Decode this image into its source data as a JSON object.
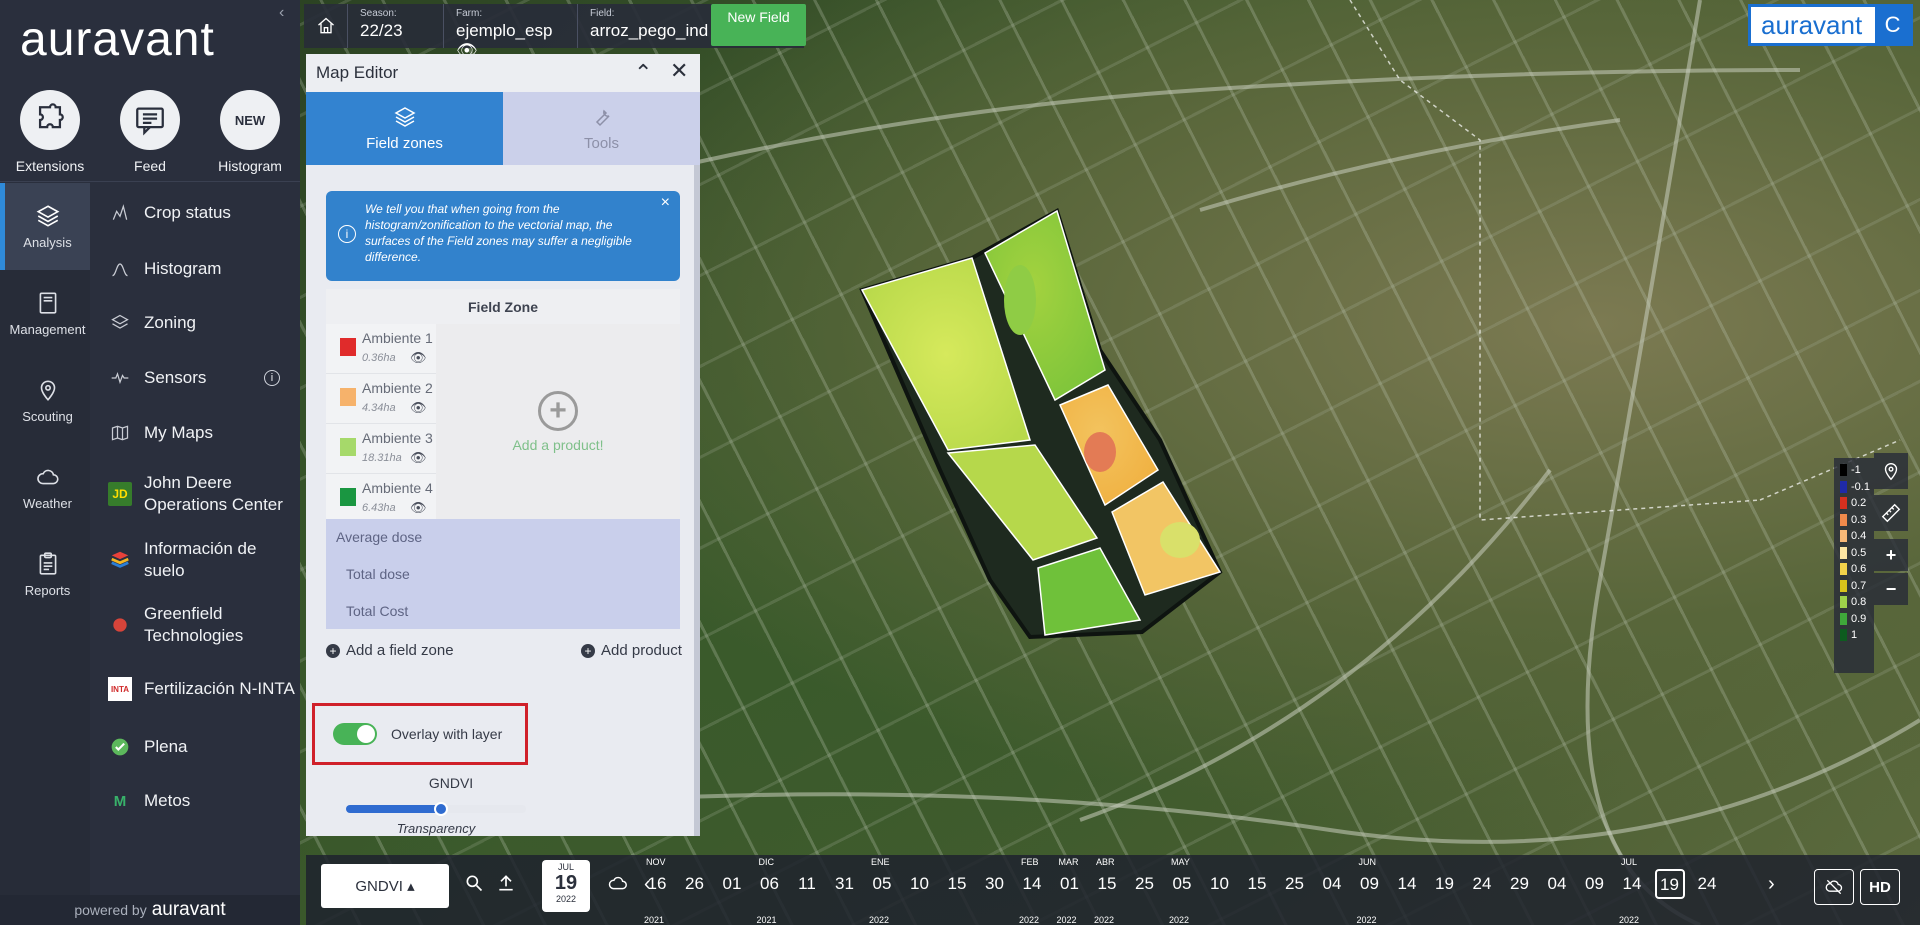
{
  "sidebar": {
    "logo": "auravant",
    "quick": [
      {
        "label": "Extensions",
        "icon": "puzzle-icon",
        "text": ""
      },
      {
        "label": "Feed",
        "icon": "chat-icon",
        "text": ""
      },
      {
        "label": "Histogram",
        "icon": "new-badge",
        "text": "NEW"
      }
    ],
    "nav": [
      {
        "label": "Analysis",
        "icon": "layers-icon",
        "active": true
      },
      {
        "label": "Management",
        "icon": "book-icon",
        "active": false
      },
      {
        "label": "Scouting",
        "icon": "map-pin-icon",
        "active": false
      },
      {
        "label": "Weather",
        "icon": "cloud-icon",
        "active": false
      },
      {
        "label": "Reports",
        "icon": "clipboard-icon",
        "active": false
      }
    ],
    "menu": [
      {
        "label": "Crop status",
        "icon": "crop-status-icon"
      },
      {
        "label": "Histogram",
        "icon": "histogram-icon"
      },
      {
        "label": "Zoning",
        "icon": "zoning-icon"
      },
      {
        "label": "Sensors",
        "icon": "sensors-icon"
      },
      {
        "label": "My Maps",
        "icon": "maps-icon"
      },
      {
        "label": "John Deere Operations Center",
        "icon": "john-deere-icon"
      },
      {
        "label": "Información de suelo",
        "icon": "soil-info-icon"
      },
      {
        "label": "Greenfield Technologies",
        "icon": "greenfield-icon"
      },
      {
        "label": "Fertilización N-INTA",
        "icon": "inta-icon"
      },
      {
        "label": "Plena",
        "icon": "plena-icon"
      },
      {
        "label": "Metos",
        "icon": "metos-icon"
      }
    ],
    "powered_prefix": "powered by",
    "powered_brand": "auravant"
  },
  "topbar": {
    "season_label": "Season:",
    "season": "22/23",
    "farm_label": "Farm:",
    "farm": "ejemplo_esp",
    "field_label": "Field:",
    "field": "arroz_pego_ind",
    "new_field": "New Field"
  },
  "brand": {
    "name": "auravant",
    "account_initial": "C",
    "color": "#1a6fd0"
  },
  "panel": {
    "title": "Map Editor",
    "tabs": [
      {
        "label": "Field zones",
        "icon": "layers-icon",
        "active": true
      },
      {
        "label": "Tools",
        "icon": "wrench-icon",
        "active": false
      }
    ],
    "info_text": "We tell you that when going from the histogram/zonification to the vectorial map, the surfaces of the Field zones may suffer a negligible difference.",
    "table_header": "Field Zone",
    "zones": [
      {
        "name": "Ambiente 1",
        "ha": "0.36ha",
        "color": "#e02b2b"
      },
      {
        "name": "Ambiente 2",
        "ha": "4.34ha",
        "color": "#f6b26b"
      },
      {
        "name": "Ambiente 3",
        "ha": "18.31ha",
        "color": "#a6d96a"
      },
      {
        "name": "Ambiente 4",
        "ha": "6.43ha",
        "color": "#1a9641"
      }
    ],
    "add_product_area": "Add a product!",
    "average_dose": "Average dose",
    "total_dose": "Total dose",
    "total_cost": "Total Cost",
    "add_field_zone": "Add a field zone",
    "add_product": "Add product",
    "overlay_label": "Overlay with layer",
    "overlay_on": true,
    "layer_name": "GNDVI",
    "transparency_label": "Transparency",
    "transparency_value": 0.5
  },
  "legend": [
    {
      "label": "-1",
      "color": "#000000"
    },
    {
      "label": "-0.1",
      "color": "#1f2aa8"
    },
    {
      "label": "0.2",
      "color": "#d7301f"
    },
    {
      "label": "0.3",
      "color": "#f08a4b"
    },
    {
      "label": "0.4",
      "color": "#f7b877"
    },
    {
      "label": "0.5",
      "color": "#fde6a3"
    },
    {
      "label": "0.6",
      "color": "#f3d34a"
    },
    {
      "label": "0.7",
      "color": "#d9c21b"
    },
    {
      "label": "0.8",
      "color": "#9fd14a"
    },
    {
      "label": "0.9",
      "color": "#3fa83a"
    },
    {
      "label": "1",
      "color": "#0d5c1f"
    }
  ],
  "bottom": {
    "layer": "GNDVI ▴",
    "date_month": "JUL",
    "date_day": "19",
    "date_year": "2022",
    "months": [
      "NOV",
      "DIC",
      "ENE",
      "FEB",
      "MAR",
      "ABR",
      "MAY",
      "JUN",
      "JUL"
    ],
    "years": [
      "2021",
      "2021",
      "2022",
      "2022",
      "2022",
      "2022",
      "2022",
      "2022",
      "2022"
    ],
    "days": [
      "16",
      "26",
      "01",
      "06",
      "11",
      "31",
      "05",
      "10",
      "15",
      "30",
      "14",
      "01",
      "15",
      "25",
      "05",
      "10",
      "15",
      "25",
      "04",
      "09",
      "14",
      "19",
      "24",
      "29",
      "04",
      "09",
      "14",
      "19",
      "24"
    ],
    "selected_day_index": 27,
    "hd": "HD"
  }
}
